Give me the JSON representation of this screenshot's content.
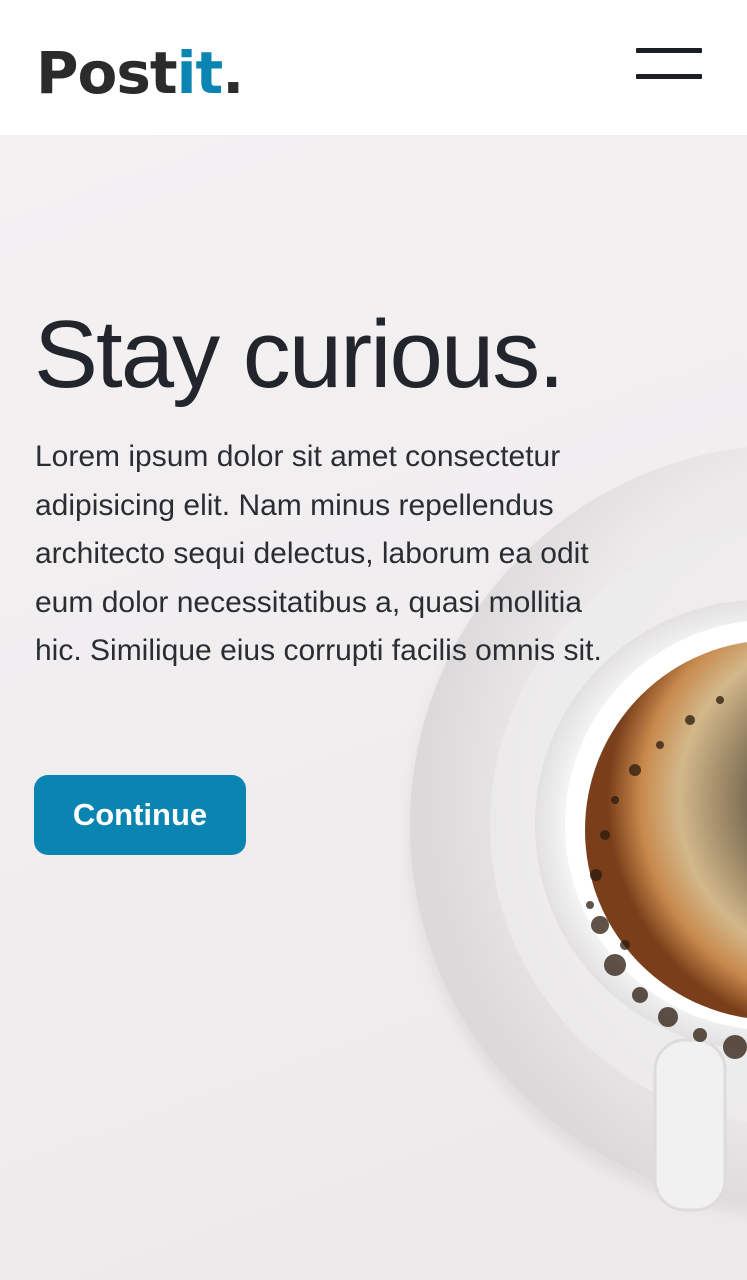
{
  "header": {
    "logo": {
      "main": "Post",
      "accent": "it",
      "dot": "."
    },
    "colors": {
      "accent": "#0a85b2",
      "text": "#2b2b2b"
    },
    "menu_icon": "hamburger-icon"
  },
  "hero": {
    "title": "Stay curious.",
    "text": "Lorem ipsum dolor sit amet consectetur adipisicing elit. Nam minus repellendus architecto sequi delectus, laborum ea odit eum dolor necessitatibus a, quasi mollitia hic. Similique eius corrupti facilis omnis sit.",
    "button_label": "Continue",
    "button_color": "#0a85b2",
    "background_image": "coffee-cup-image"
  }
}
